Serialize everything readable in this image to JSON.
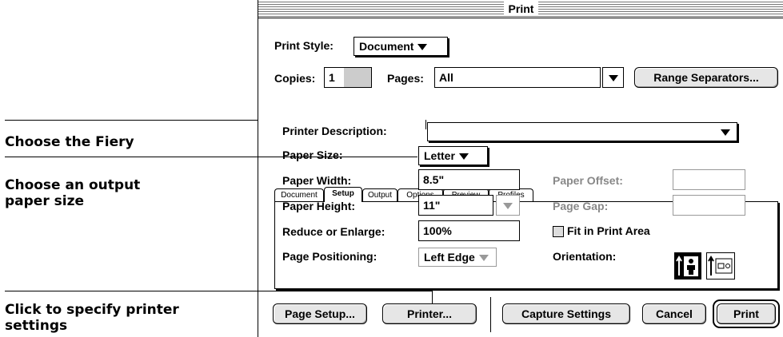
{
  "window": {
    "title": "Print"
  },
  "print_style": {
    "label": "Print Style:",
    "value": "Document"
  },
  "copies": {
    "label": "Copies:",
    "value": "1"
  },
  "pages": {
    "label": "Pages:",
    "value": "All"
  },
  "range_button": "Range Separators...",
  "tabs": [
    "Document",
    "Setup",
    "Output",
    "Options",
    "Preview",
    "Profiles"
  ],
  "active_tab": "Setup",
  "setup": {
    "printer_description": {
      "label": "Printer Description:",
      "value": ""
    },
    "paper_size": {
      "label": "Paper Size:",
      "value": "Letter"
    },
    "paper_width": {
      "label": "Paper Width:",
      "value": "8.5\""
    },
    "paper_height": {
      "label": "Paper Height:",
      "value": "11\""
    },
    "reduce_enlarge": {
      "label": "Reduce or Enlarge:",
      "value": "100%"
    },
    "page_positioning": {
      "label": "Page Positioning:",
      "value": "Left Edge"
    },
    "paper_offset": {
      "label": "Paper Offset:",
      "value": ""
    },
    "page_gap": {
      "label": "Page Gap:",
      "value": ""
    },
    "fit_print_area": {
      "label": "Fit in Print Area",
      "checked": false
    },
    "orientation": {
      "label": "Orientation:",
      "selected": "portrait"
    }
  },
  "buttons": {
    "page_setup": "Page Setup...",
    "printer": "Printer...",
    "capture": "Capture Settings",
    "cancel": "Cancel",
    "print": "Print"
  },
  "callouts": {
    "fiery": "Choose the Fiery",
    "paper_size_1": "Choose an output",
    "paper_size_2": "paper size",
    "printer_settings_1": "Click to specify printer",
    "printer_settings_2": "settings"
  }
}
